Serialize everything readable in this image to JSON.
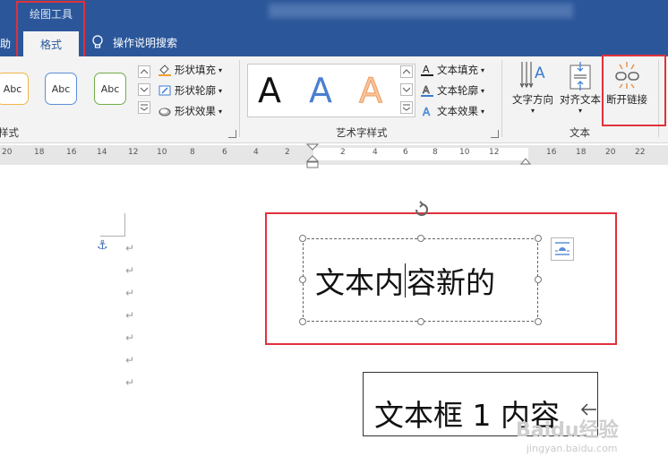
{
  "ribbon_tabs": {
    "context_title": "绘图工具",
    "left_partial": "助",
    "active": "格式",
    "tell_me": "操作说明搜索"
  },
  "shape_styles": {
    "thumbs": [
      "Abc",
      "Abc",
      "Abc"
    ],
    "fill": "形状填充",
    "outline": "形状轮廓",
    "effect": "形状效果",
    "group_label": "样式"
  },
  "wordart": {
    "glyphs": [
      "A",
      "A",
      "A"
    ],
    "text_fill": "文本填充",
    "text_outline": "文本轮廓",
    "text_effect": "文本效果",
    "group_label": "艺术字样式"
  },
  "text_group": {
    "direction": "文字方向",
    "align": "对齐文本",
    "break_link": "断开链接",
    "group_label": "文本"
  },
  "ruler": {
    "left_ticks": [
      "20",
      "18",
      "16",
      "14",
      "12",
      "10",
      "8",
      "6",
      "4",
      "2"
    ],
    "right_ticks": [
      "2",
      "4",
      "6",
      "8",
      "10",
      "12",
      "16",
      "18",
      "20",
      "22"
    ]
  },
  "document": {
    "textbox1_before": "文本内",
    "textbox1_after": "容新的",
    "textbox2_text": "文本框 1 内容",
    "paragraph_mark": "↵",
    "anchor": "⚓"
  },
  "watermark": "Baidu经验",
  "watermark_url": "jingyan.baidu.com",
  "colors": {
    "title_blue": "#2b579a",
    "highlight_red": "#e0313b",
    "wordart_blue": "#4a7fd0",
    "wordart_orange": "#f2a26b"
  }
}
